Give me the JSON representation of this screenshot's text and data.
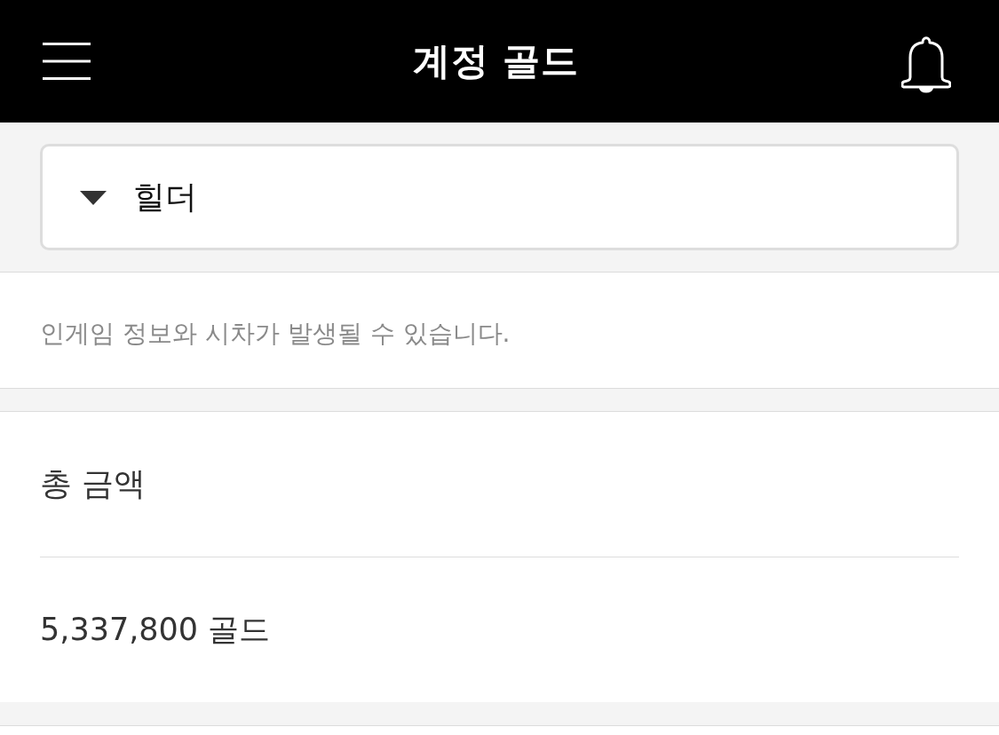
{
  "header": {
    "title": "계정 골드"
  },
  "server_select": {
    "value": "힐더"
  },
  "notice": "인게임 정보와 시차가 발생될 수 있습니다.",
  "total": {
    "label": "총 금액",
    "amount": "5,337,800 골드"
  }
}
